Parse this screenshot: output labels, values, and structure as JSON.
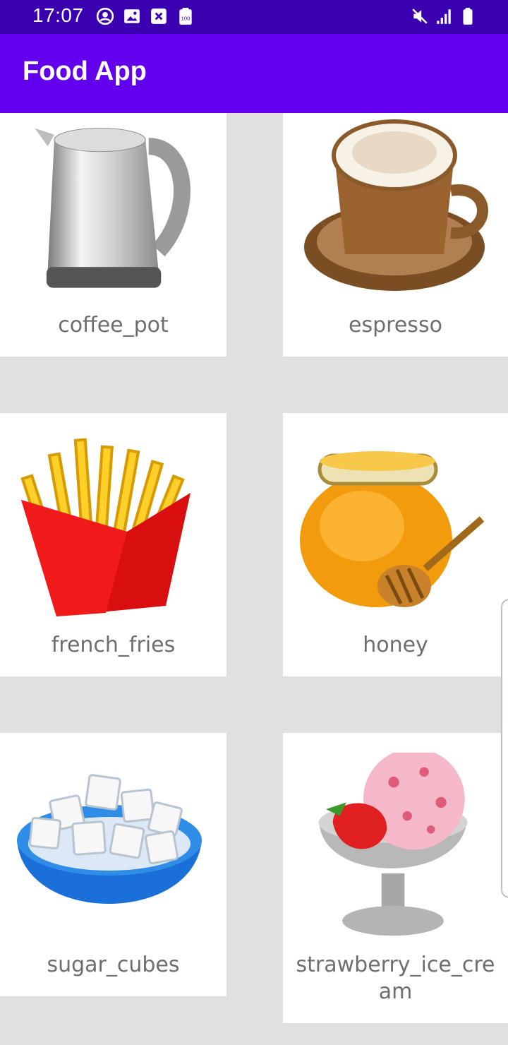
{
  "status_bar": {
    "time": "17:07",
    "left_icons": [
      "account-circle-icon",
      "image-icon",
      "close-box-icon",
      "battery-100-icon"
    ],
    "right_icons": [
      "mute-icon",
      "signal-icon",
      "battery-icon"
    ]
  },
  "app_bar": {
    "title": "Food App"
  },
  "colors": {
    "status_bar": "#3a00b0",
    "app_bar": "#6200ee",
    "background": "#e2e0e1",
    "card": "#ffffff",
    "label": "#6e6e6e"
  },
  "grid": {
    "items": [
      {
        "label": "coffee_pot",
        "icon": "kettle-icon"
      },
      {
        "label": "espresso",
        "icon": "coffee-cup-icon"
      },
      {
        "label": "french_fries",
        "icon": "french-fries-icon"
      },
      {
        "label": "honey",
        "icon": "honey-pot-icon"
      },
      {
        "label": "sugar_cubes",
        "icon": "sugar-bowl-icon"
      },
      {
        "label": "strawberry_ice_cream",
        "icon": "ice-cream-icon"
      }
    ]
  }
}
